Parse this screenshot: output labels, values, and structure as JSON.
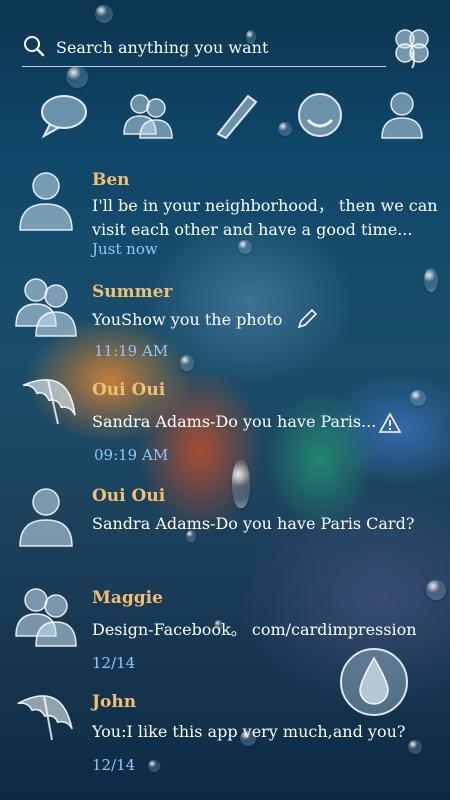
{
  "search": {
    "placeholder": "Search anything you want"
  },
  "toolbar": {
    "icons": [
      "chat-bubble-icon",
      "contacts-icon",
      "compose-icon",
      "smiley-icon",
      "profile-icon"
    ]
  },
  "conversations": [
    {
      "name": "Ben",
      "message": "I'll be in your neighborhood， then we can visit each other and have a good time...",
      "time": "Just now",
      "avatar": "single-person-icon"
    },
    {
      "name": "Summer",
      "message": "YouShow you the photo",
      "time": "11:19 AM",
      "avatar": "group-person-icon",
      "status_icon": "pencil-icon"
    },
    {
      "name": "Oui Oui",
      "message": "Sandra Adams-Do you have Paris...",
      "time": "09:19 AM",
      "avatar": "umbrella-icon",
      "status_icon": "warning-icon"
    },
    {
      "name": "Oui Oui",
      "message": "Sandra Adams-Do you have Paris Card?",
      "time": "",
      "avatar": "single-person-icon"
    },
    {
      "name": "Maggie",
      "message": "Design-Facebook。 com/cardimpression",
      "time": "12/14",
      "avatar": "group-person-icon"
    },
    {
      "name": "John",
      "message": "You:I like this app very much,and you?",
      "time": "12/14",
      "avatar": "umbrella-icon"
    }
  ],
  "fab": {
    "icon": "water-drop-icon"
  }
}
